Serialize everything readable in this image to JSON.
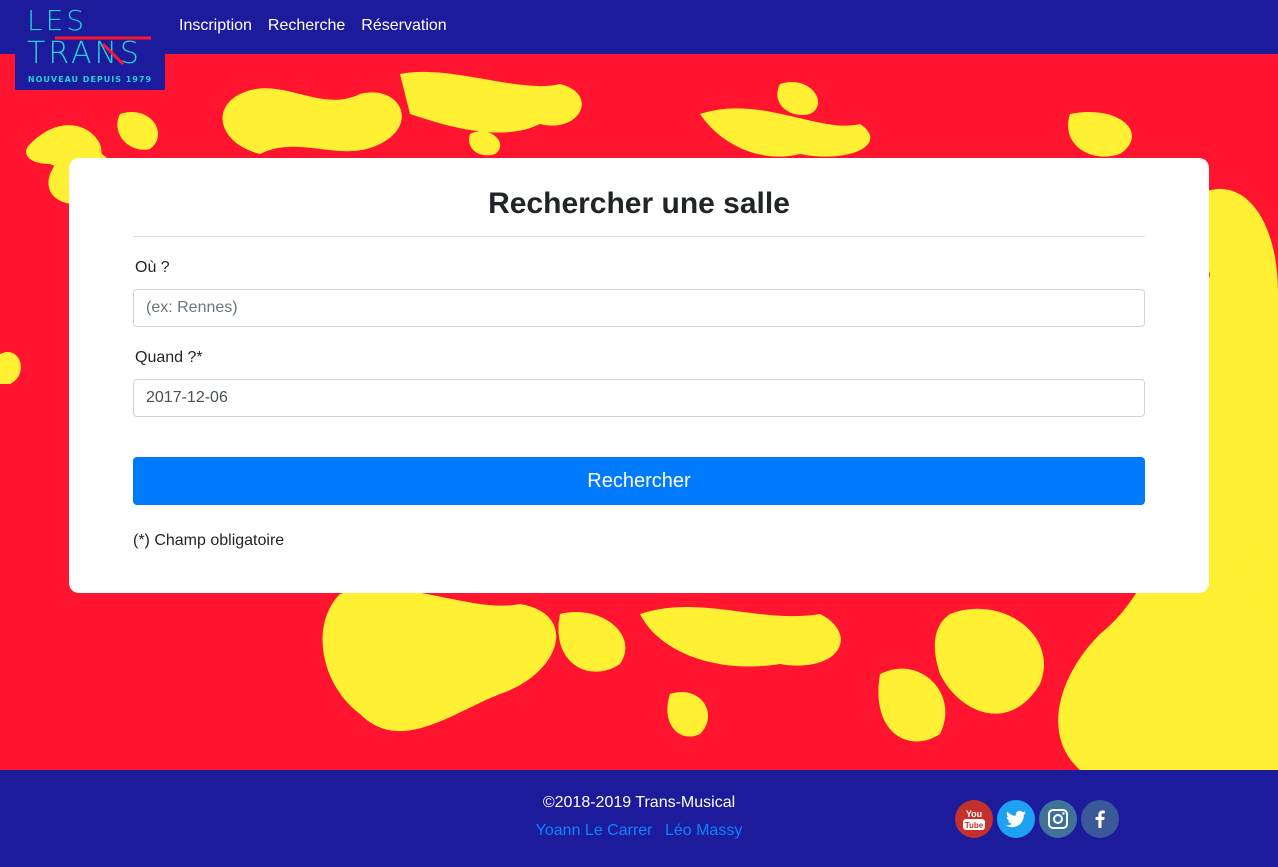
{
  "logo": {
    "line1": "LES",
    "line2": "TRANS",
    "tagline": "NOUVEAU DEPUIS 1979"
  },
  "nav": {
    "items": [
      {
        "label": "Inscription"
      },
      {
        "label": "Recherche"
      },
      {
        "label": "Réservation"
      }
    ]
  },
  "search_card": {
    "title": "Rechercher une salle",
    "where_label": "Où ?",
    "where_placeholder": "(ex: Rennes)",
    "where_value": "",
    "when_label": "Quand ?*",
    "when_value": "2017-12-06",
    "submit_label": "Rechercher",
    "required_note": "(*) Champ obligatoire"
  },
  "footer": {
    "copyright": "©2018-2019 Trans-Musical",
    "authors": [
      {
        "name": "Yoann Le Carrer"
      },
      {
        "name": "Léo Massy"
      }
    ],
    "socials": [
      {
        "icon": "youtube-icon",
        "text": "You Tube",
        "color": "#c4302b"
      },
      {
        "icon": "twitter-icon",
        "color": "#1da1f2"
      },
      {
        "icon": "instagram-icon",
        "color": "#3f729b"
      },
      {
        "icon": "facebook-icon",
        "color": "#3b5998"
      }
    ]
  },
  "colors": {
    "navbar": "#1c1b9c",
    "background": "#ff1530",
    "splash": "#fff033",
    "button": "#007bff",
    "link": "#0a84ff"
  }
}
